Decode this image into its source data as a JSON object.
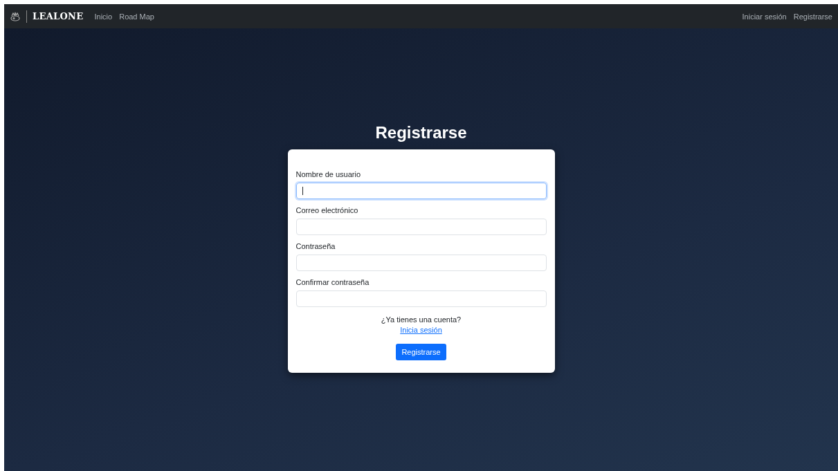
{
  "navbar": {
    "brand": "LEALONE",
    "links": [
      {
        "label": "Inicio"
      },
      {
        "label": "Road Map"
      }
    ],
    "right_links": [
      {
        "label": "Iniciar sesión"
      },
      {
        "label": "Registrarse"
      }
    ]
  },
  "heading": "Registrarse",
  "form": {
    "fields": [
      {
        "label": "Nombre de usuario",
        "focused": true
      },
      {
        "label": "Correo electrónico",
        "focused": false
      },
      {
        "label": "Contraseña",
        "focused": false
      },
      {
        "label": "Confirmar contraseña",
        "focused": false
      }
    ],
    "prompt": "¿Ya tienes una cuenta?",
    "login_link": "Inicia sesión",
    "submit": "Registrarse"
  }
}
